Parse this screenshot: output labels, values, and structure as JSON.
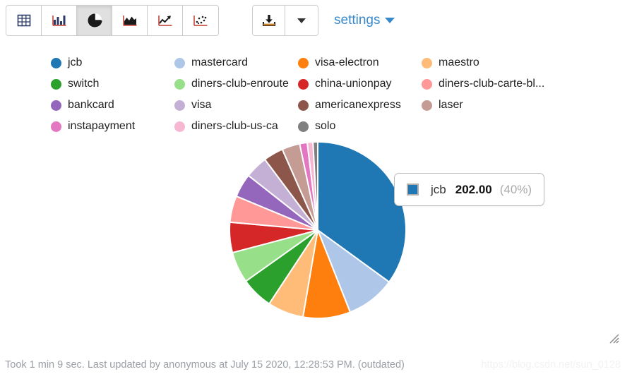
{
  "toolbar": {
    "viz_buttons": [
      {
        "name": "table",
        "icon": "table-icon",
        "label": "table",
        "active": false
      },
      {
        "name": "bar",
        "icon": "bar-chart-icon",
        "label": "bar chart",
        "active": false
      },
      {
        "name": "pie",
        "icon": "pie-chart-icon",
        "label": "pie chart",
        "active": true
      },
      {
        "name": "area",
        "icon": "area-chart-icon",
        "label": "area chart",
        "active": false
      },
      {
        "name": "line",
        "icon": "line-chart-icon",
        "label": "line chart",
        "active": false
      },
      {
        "name": "scatter",
        "icon": "scatter-plot-icon",
        "label": "scatter plot",
        "active": false
      }
    ],
    "download": {
      "icon": "download-icon",
      "label": "download"
    },
    "download_caret": {
      "icon": "caret-down-icon",
      "label": "download options"
    },
    "settings": {
      "label": "settings",
      "icon": "caret-down-icon",
      "color": "#3888cc"
    }
  },
  "chart_data": {
    "type": "pie",
    "title": "",
    "legend_position": "top",
    "categories": [
      "jcb",
      "mastercard",
      "visa-electron",
      "maestro",
      "switch",
      "diners-club-enroute",
      "china-unionpay",
      "diners-club-carte-bl...",
      "bankcard",
      "visa",
      "americanexpress",
      "laser",
      "instapayment",
      "diners-club-us-ca",
      "solo"
    ],
    "values": [
      202,
      52,
      50,
      38,
      34,
      33,
      32,
      28,
      25,
      24,
      21,
      19,
      8,
      6,
      5
    ],
    "colors": [
      "#1f77b4",
      "#aec7e8",
      "#ff7f0e",
      "#ffbb78",
      "#2ca02c",
      "#98df8a",
      "#d62728",
      "#ff9896",
      "#9467bd",
      "#c5b0d5",
      "#8c564b",
      "#c49c94",
      "#e377c2",
      "#f7b6d2",
      "#7f7f7f"
    ],
    "highlighted": "jcb",
    "highlighted_value": "202.00",
    "highlighted_percent": "(40%)"
  },
  "legend": [
    {
      "label": "jcb",
      "color": "#1f77b4"
    },
    {
      "label": "mastercard",
      "color": "#aec7e8"
    },
    {
      "label": "visa-electron",
      "color": "#ff7f0e"
    },
    {
      "label": "maestro",
      "color": "#ffbb78"
    },
    {
      "label": "switch",
      "color": "#2ca02c"
    },
    {
      "label": "diners-club-enroute",
      "color": "#98df8a"
    },
    {
      "label": "china-unionpay",
      "color": "#d62728"
    },
    {
      "label": "diners-club-carte-bl...",
      "color": "#ff9896"
    },
    {
      "label": "bankcard",
      "color": "#9467bd"
    },
    {
      "label": "visa",
      "color": "#c5b0d5"
    },
    {
      "label": "americanexpress",
      "color": "#8c564b"
    },
    {
      "label": "laser",
      "color": "#c49c94"
    },
    {
      "label": "instapayment",
      "color": "#e377c2"
    },
    {
      "label": "diners-club-us-ca",
      "color": "#f7b6d2"
    },
    {
      "label": "solo",
      "color": "#7f7f7f"
    }
  ],
  "tooltip": {
    "series": "jcb",
    "value": "202.00",
    "percent": "(40%)",
    "color": "#1f77b4"
  },
  "footer": {
    "status": "Took 1 min 9 sec. Last updated by anonymous at July 15 2020, 12:28:53 PM. (outdated)"
  },
  "watermark": {
    "text": "https://blog.csdn.net/sun_0128"
  }
}
